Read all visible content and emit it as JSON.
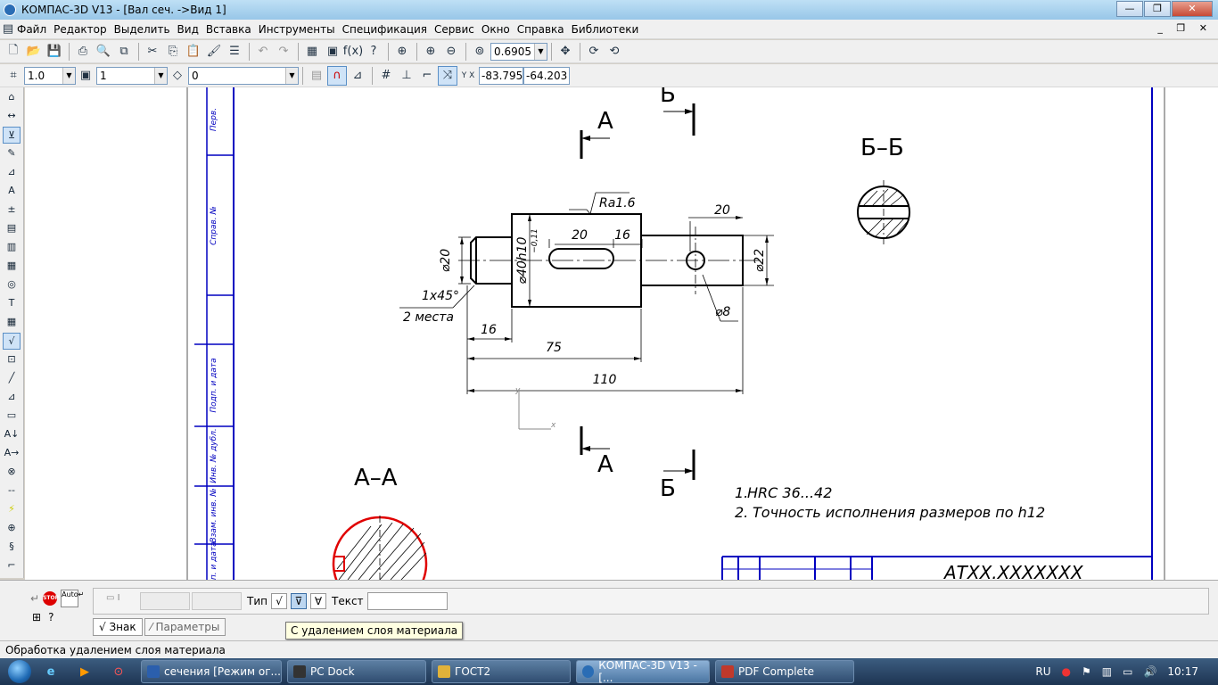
{
  "window": {
    "title": "КОМПАС-3D V13 - [Вал сеч. ->Вид 1]"
  },
  "menu": [
    "Файл",
    "Редактор",
    "Выделить",
    "Вид",
    "Вставка",
    "Инструменты",
    "Спецификация",
    "Сервис",
    "Окно",
    "Справка",
    "Библиотеки"
  ],
  "toolbar": {
    "zoom": "0.6905",
    "style_value": "1.0",
    "layer_value": "1",
    "state_value": "0",
    "coord_x": "-83.795",
    "coord_y": "-64.203"
  },
  "drawing": {
    "section_a_top": "А",
    "section_a_bottom": "А",
    "section_b_top": "Б",
    "section_b_bottom": "Б",
    "view_bb": "Б–Б",
    "view_aa": "А–А",
    "roughness": "Ra1.6",
    "dim_20_top": "20",
    "dim_20_key": "20",
    "dim_16_key": "16",
    "dim_d20": "⌀20",
    "dim_d40": "⌀40h10",
    "dim_d40_sub": "−0,11",
    "dim_d22": "⌀22",
    "dim_d8": "⌀8",
    "chamfer": "1x45°",
    "chamfer_note": "2 места",
    "dim_16": "16",
    "dim_75": "75",
    "dim_110": "110",
    "axis_x": "x",
    "axis_y": "y",
    "note_1_num": "1.",
    "note_1": "HRC  36...42",
    "note_2_num": "2.",
    "note_2": "Точность исполнения размеров по h12",
    "stamp_code": "АТХХ.ХХХХХХХ",
    "frame_labels": [
      "Перв.",
      "Справ. №",
      "Подп. и дата",
      "Инв. № дубл.",
      "Взам. инв. №",
      "Подп. и дата"
    ]
  },
  "properties": {
    "type_label": "Тип",
    "text_label": "Текст",
    "tab_sign": "Знак",
    "tab_params": "Параметры",
    "tooltip": "С удалением слоя материала",
    "auto_label": "Auto",
    "stop_label": "STOP"
  },
  "status": "Обработка удалением слоя материала",
  "taskbar": {
    "tasks": [
      {
        "label": "сечения [Режим ог...",
        "color": "#2b5fad",
        "active": false
      },
      {
        "label": "PC Dock",
        "color": "#333333",
        "active": false
      },
      {
        "label": "ГОСТ2",
        "color": "#e0b23a",
        "active": false
      },
      {
        "label": "КОМПАС-3D V13 - [...",
        "color": "#2a6db5",
        "active": true
      },
      {
        "label": "PDF Complete",
        "color": "#c0392b",
        "active": false
      }
    ],
    "lang": "RU",
    "time": "10:17"
  }
}
